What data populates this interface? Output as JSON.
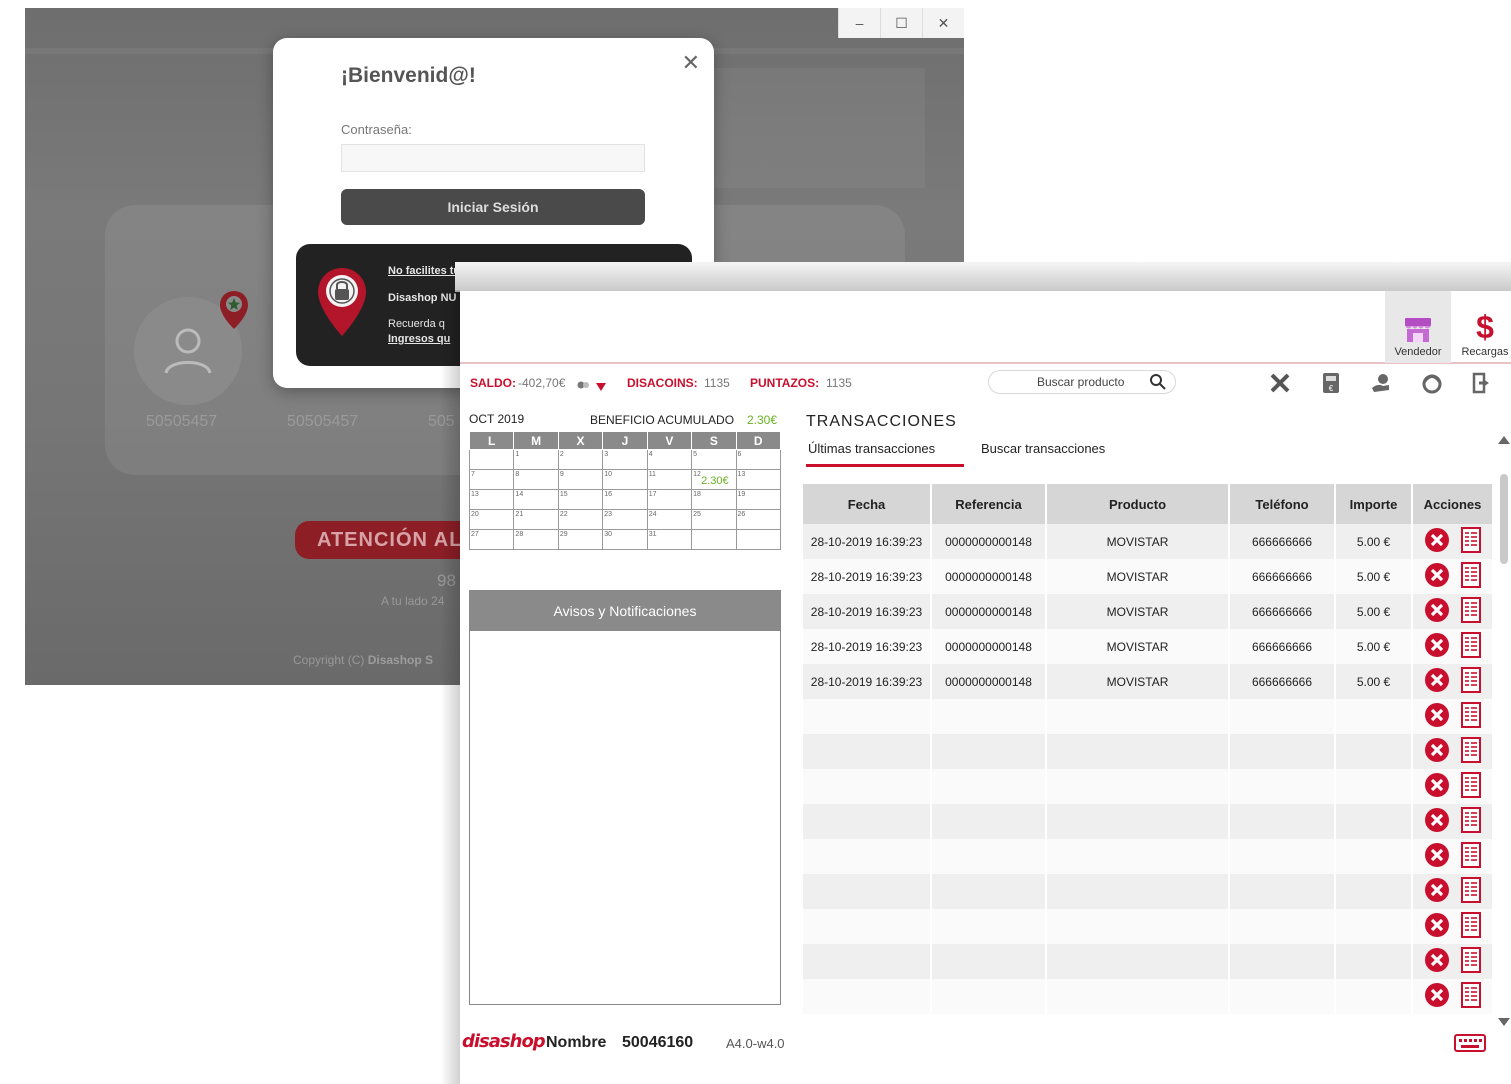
{
  "login_window": {
    "window_controls": {
      "minimize": "–",
      "maximize": "☐",
      "close": "✕"
    },
    "modal": {
      "title": "¡Bienvenid@!",
      "close": "✕",
      "password_label": "Contraseña:",
      "password_value": "",
      "login_button": "Iniciar Sesión"
    },
    "notice": {
      "line1": "No facilites tu id de cliente a NADIE.",
      "line2": "Disashop NU",
      "line3": "Recuerda q",
      "line4": "Ingresos qu"
    },
    "users": [
      "50505457",
      "50505457",
      "505"
    ],
    "attention_button": "ATENCIÓN AL",
    "phone": "98",
    "tagline": "A tu lado 24",
    "copyright": "Copyright (C)",
    "copyright_brand": "Disashop S"
  },
  "main_window": {
    "top_buttons": {
      "vendedor": "Vendedor",
      "recargas": "Recargas"
    },
    "status": {
      "saldo_label": "SALDO:",
      "saldo_value": "-402,70€",
      "disacoins_label": "DISACOINS:",
      "disacoins_value": "1135",
      "puntazos_label": "PUNTAZOS:",
      "puntazos_value": "1135",
      "search_placeholder": "Buscar producto"
    },
    "calendar": {
      "month": "OCT 2019",
      "benefit_label": "BENEFICIO ACUMULADO",
      "benefit_value": "2.30€",
      "weekdays": [
        "L",
        "M",
        "X",
        "J",
        "V",
        "S",
        "D"
      ],
      "weeks": [
        [
          "",
          "1",
          "2",
          "3",
          "4",
          "5",
          "6"
        ],
        [
          "7",
          "8",
          "9",
          "10",
          "11",
          "12",
          "13"
        ],
        [
          "13",
          "14",
          "15",
          "16",
          "17",
          "18",
          "19"
        ],
        [
          "20",
          "21",
          "22",
          "23",
          "24",
          "25",
          "26"
        ],
        [
          "27",
          "28",
          "29",
          "30",
          "31",
          "",
          ""
        ]
      ],
      "day_amount": "2.30€"
    },
    "avisos_title": "Avisos y Notificaciones",
    "transactions": {
      "title": "TRANSACCIONES",
      "tab_last": "Últimas transacciones",
      "tab_search": "Buscar transacciones",
      "headers": [
        "Fecha",
        "Referencia",
        "Producto",
        "Teléfono",
        "Importe",
        "Acciones"
      ],
      "rows": [
        [
          "28-10-2019 16:39:23",
          "0000000000148",
          "MOVISTAR",
          "666666666",
          "5.00 €"
        ],
        [
          "28-10-2019 16:39:23",
          "0000000000148",
          "MOVISTAR",
          "666666666",
          "5.00 €"
        ],
        [
          "28-10-2019 16:39:23",
          "0000000000148",
          "MOVISTAR",
          "666666666",
          "5.00 €"
        ],
        [
          "28-10-2019 16:39:23",
          "0000000000148",
          "MOVISTAR",
          "666666666",
          "5.00 €"
        ],
        [
          "28-10-2019 16:39:23",
          "0000000000148",
          "MOVISTAR",
          "666666666",
          "5.00 €"
        ],
        [
          "",
          "",
          "",
          "",
          ""
        ],
        [
          "",
          "",
          "",
          "",
          ""
        ],
        [
          "",
          "",
          "",
          "",
          ""
        ],
        [
          "",
          "",
          "",
          "",
          ""
        ],
        [
          "",
          "",
          "",
          "",
          ""
        ],
        [
          "",
          "",
          "",
          "",
          ""
        ],
        [
          "",
          "",
          "",
          "",
          ""
        ],
        [
          "",
          "",
          "",
          "",
          ""
        ],
        [
          "",
          "",
          "",
          "",
          ""
        ]
      ]
    },
    "footer": {
      "brand": "disashop",
      "name_label": "Nombre",
      "client_id": "50046160",
      "version": "A4.0-w4.0"
    }
  },
  "colors": {
    "brand_red": "#c8102e",
    "benefit_green": "#6ab023",
    "vendedor_purple": "#b24ec2",
    "calendar_header": "#8a8a8a"
  },
  "icons": [
    "close-icon",
    "user-icon",
    "map-pin-star-icon",
    "lock-pin-icon",
    "shop-icon",
    "dollar-icon",
    "coin-icon",
    "caret-down-icon",
    "search-icon",
    "tools-icon",
    "calculator-icon",
    "hand-coin-icon",
    "support-icon",
    "logout-icon",
    "cancel-icon",
    "receipt-icon",
    "keyboard-icon"
  ]
}
